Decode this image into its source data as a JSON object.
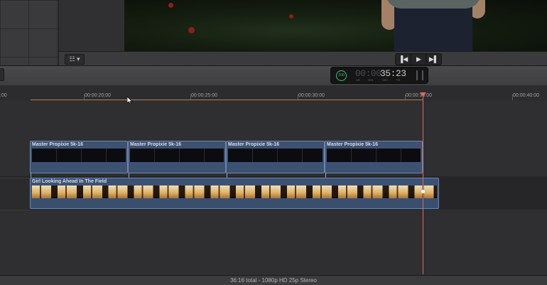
{
  "viewer": {
    "view_options_label": "☷ ▾",
    "transport": {
      "prev_icon": "skip-back-icon",
      "play_icon": "play-icon",
      "next_icon": "skip-forward-icon"
    }
  },
  "toolbar": {
    "timecode": {
      "badge": "100",
      "dim_digits": "00:00",
      "main_digits": "35:23",
      "units": [
        "HR",
        "MIN",
        "SEC",
        "FR"
      ]
    }
  },
  "ruler": {
    "labels": [
      ":00",
      "00:00:20:00",
      "00:00:25:00",
      "00:00:30:00",
      "00:00:35:00",
      "00:00:40:00"
    ]
  },
  "timeline": {
    "connected_clips": [
      {
        "title": "Master Propixie 5k-16"
      },
      {
        "title": "Master Propixie 5k-16"
      },
      {
        "title": "Master Propixie 5k-16"
      },
      {
        "title": "Master Propixie 5k-16"
      }
    ],
    "primary_clip": {
      "title": "Girl Looking Ahead In The Field"
    }
  },
  "status_bar": {
    "text": "36:16 total - 1080p HD 25p Stereo"
  },
  "colors": {
    "clip_blue": "#3d5272",
    "playhead": "#e06a5e",
    "range_orange": "#c9763a",
    "timecode_green": "#3cc07a"
  }
}
